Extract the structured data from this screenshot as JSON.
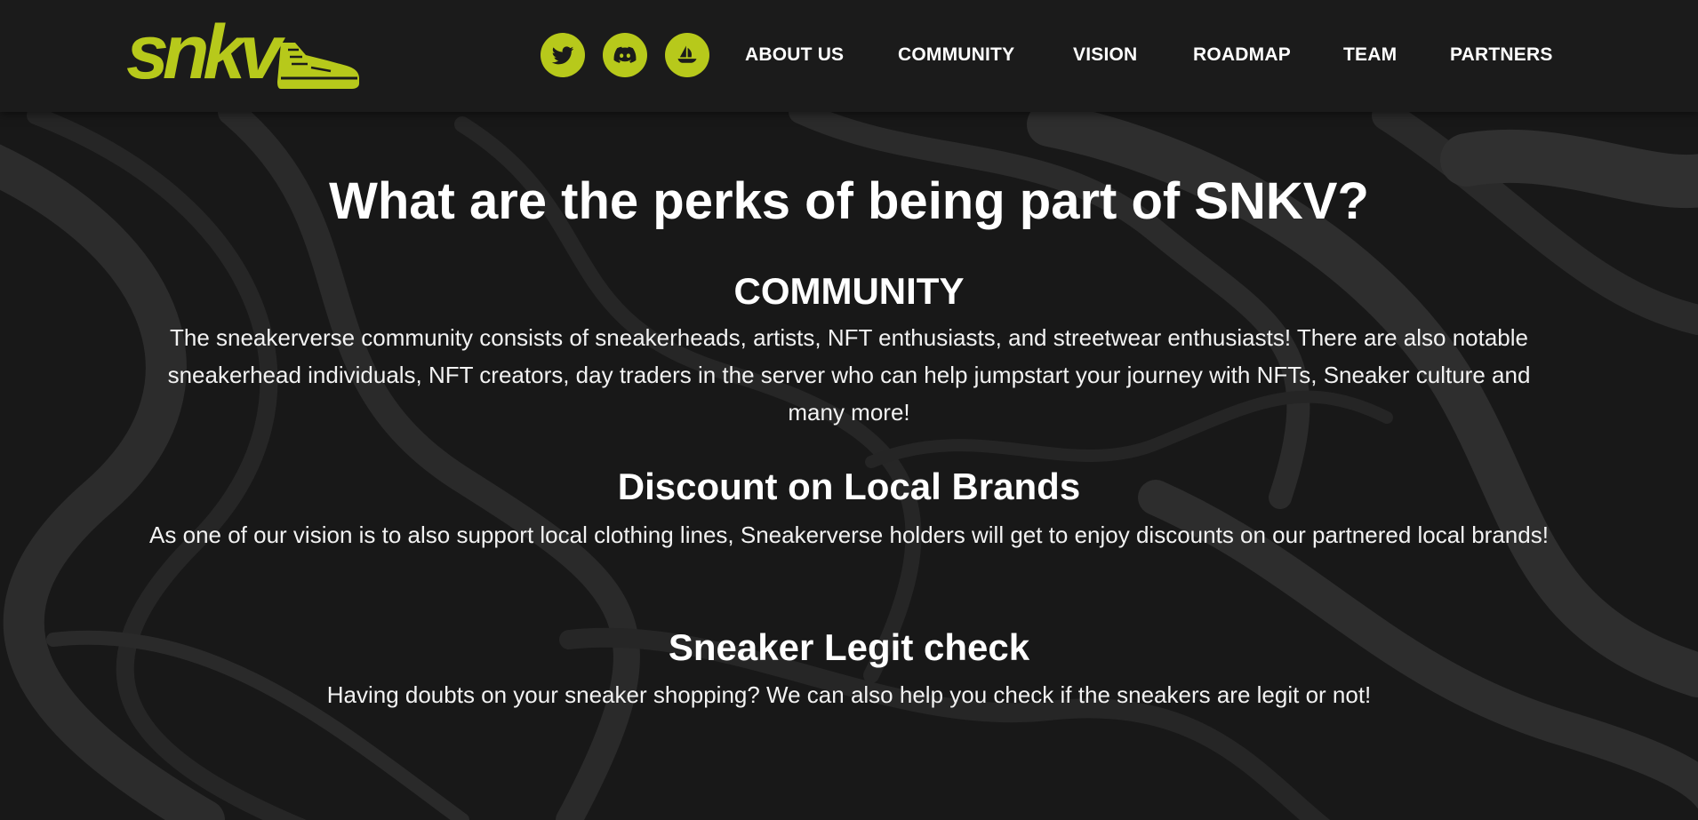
{
  "header": {
    "logo_text": "snkv",
    "social": [
      {
        "icon": "twitter-icon"
      },
      {
        "icon": "discord-icon"
      },
      {
        "icon": "opensea-icon"
      }
    ],
    "nav": [
      "ABOUT US",
      "COMMUNITY",
      "VISION",
      "ROADMAP",
      "TEAM",
      "PARTNERS"
    ]
  },
  "main": {
    "title": "What are the perks of being part of SNKV?",
    "sections": [
      {
        "title": "COMMUNITY",
        "body": "The sneakerverse community consists of sneakerheads, artists, NFT enthusiasts, and streetwear enthusiasts! There are also notable sneakerhead individuals, NFT creators, day traders in the server who can help jumpstart your journey with NFTs, Sneaker culture and many more!"
      },
      {
        "title": "Discount on Local Brands",
        "body": "As one of our vision is to also support local clothing lines, Sneakerverse holders will get to enjoy discounts on our partnered local brands!"
      },
      {
        "title": "Sneaker Legit check",
        "body": "Having doubts on your sneaker shopping? We can also help you check if the sneakers are legit or not!"
      }
    ]
  },
  "colors": {
    "accent": "#b7c91b",
    "header_bg": "#1b1b1b",
    "page_bg": "#191919",
    "text": "#ffffff"
  }
}
